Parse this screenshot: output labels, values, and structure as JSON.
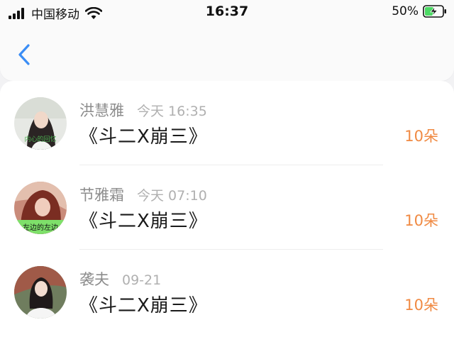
{
  "status_bar": {
    "carrier": "中国移动",
    "time": "16:37",
    "battery": "50%",
    "icons": [
      "signal-icon",
      "wifi-icon",
      "battery-charging-icon"
    ]
  },
  "nav": {
    "back_icon": "chevron-left-icon",
    "accent_color": "#3a8df5"
  },
  "items": [
    {
      "name": "洪慧雅",
      "time": "今天 16:35",
      "title": "《斗二X崩三》",
      "count": "10朵",
      "avatar_caption": "内心的回忆"
    },
    {
      "name": "节雅霜",
      "time": "今天 07:10",
      "title": "《斗二X崩三》",
      "count": "10朵",
      "avatar_caption": "左边的左边"
    },
    {
      "name": "袭夫",
      "time": "09-21",
      "title": "《斗二X崩三》",
      "count": "10朵"
    }
  ],
  "colors": {
    "count": "#f08a43",
    "name": "#8c8c8c",
    "time": "#b0b0b0"
  }
}
